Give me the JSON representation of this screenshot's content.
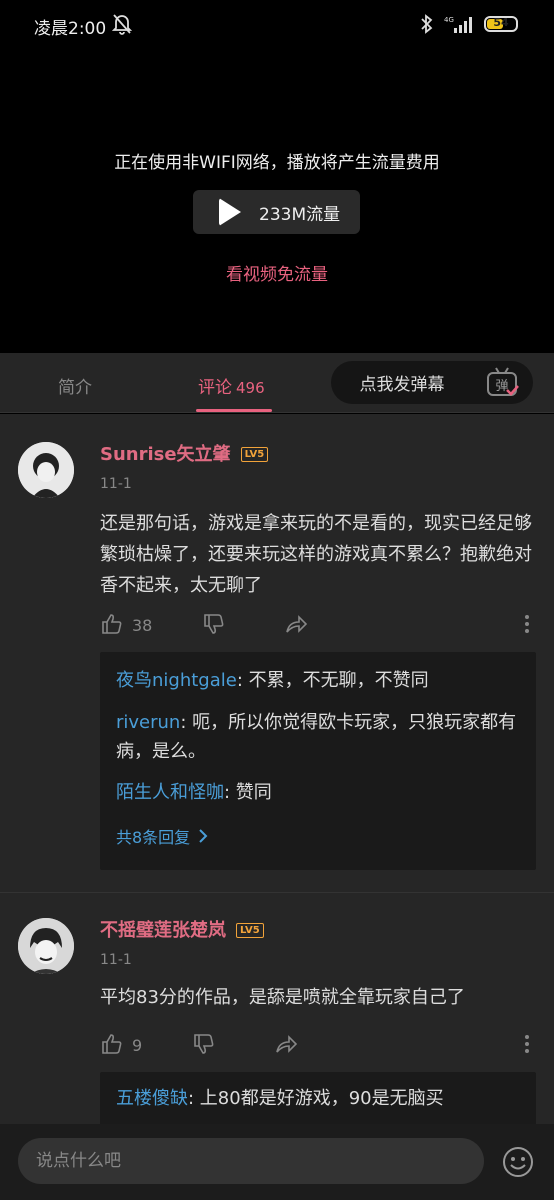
{
  "status_bar": {
    "time": "凌晨2:00",
    "network": "4G",
    "battery": "54"
  },
  "video": {
    "notice": "正在使用非WIFI网络，播放将产生流量费用",
    "play_label": "233M流量",
    "free_link": "看视频免流量"
  },
  "tabs": {
    "intro": "简介",
    "comments": "评论",
    "comments_count": "496",
    "danmaku_button": "点我发弹幕",
    "danmaku_toggle": "弹"
  },
  "comments": [
    {
      "username": "Sunrise矢立肇",
      "level": "LV5",
      "date": "11-1",
      "text": "还是那句话，游戏是拿来玩的不是看的，现实已经足够繁琐枯燥了，还要来玩这样的游戏真不累么？抱歉绝对香不起来，太无聊了",
      "likes": "38",
      "replies": [
        {
          "user": "夜鸟nightgale",
          "text": ": 不累，不无聊，不赞同"
        },
        {
          "user": "riverun",
          "text": ": 呃，所以你觉得欧卡玩家，只狼玩家都有病，是么。"
        },
        {
          "user": "陌生人和怪咖",
          "text": ": 赞同"
        }
      ],
      "more_replies": "共8条回复"
    },
    {
      "username": "不摇璧莲张楚岚",
      "level": "LV5",
      "date": "11-1",
      "text": "平均83分的作品，是舔是喷就全靠玩家自己了",
      "likes": "9",
      "replies": [
        {
          "user": "五楼傻缺",
          "text": ": 上80都是好游戏，90是无脑买"
        }
      ]
    }
  ],
  "input": {
    "placeholder": "说点什么吧"
  },
  "colors": {
    "accent": "#e8627f",
    "link": "#4a9ed8",
    "level": "#f2a33a"
  }
}
